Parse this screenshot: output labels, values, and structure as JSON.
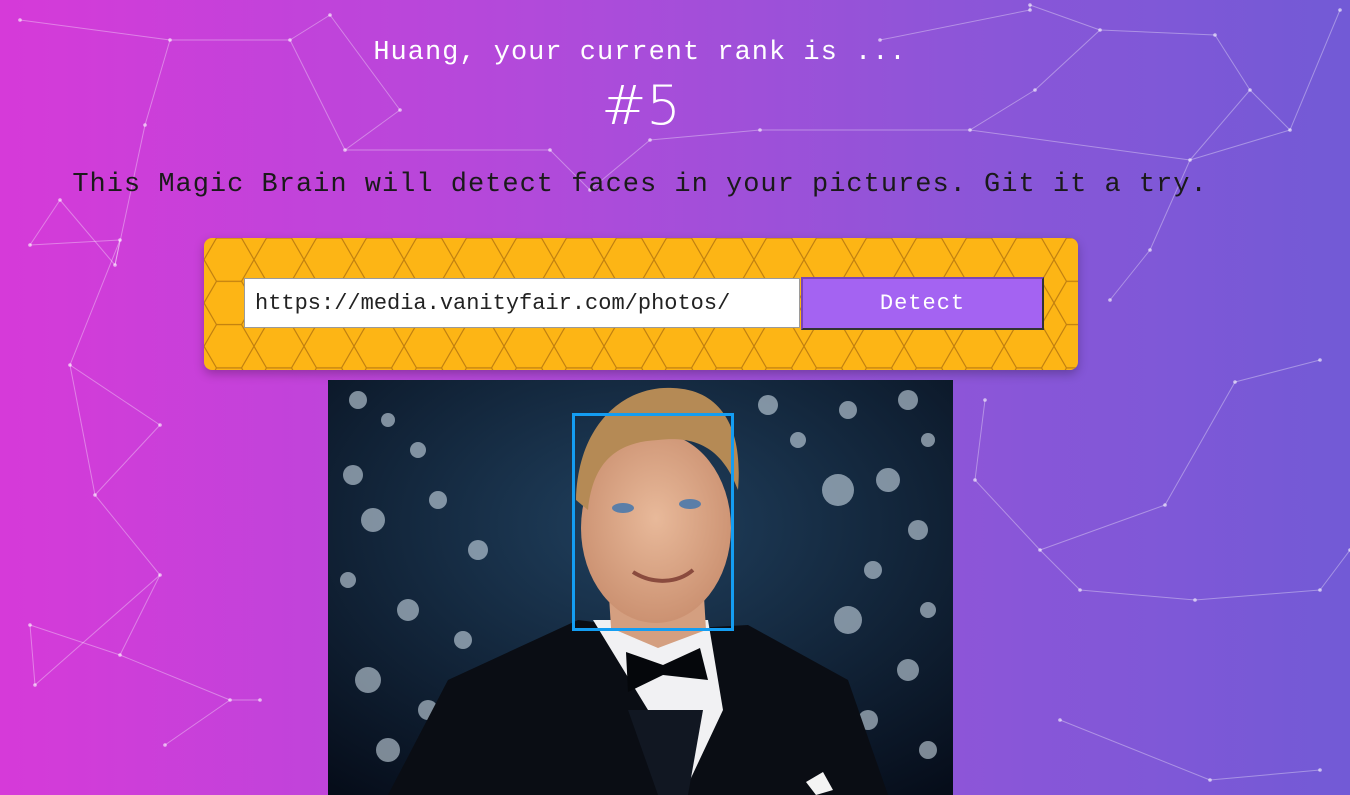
{
  "rank": {
    "greeting": "Huang, your current rank is ...",
    "number": "#5"
  },
  "description": "This Magic Brain will detect faces in your pictures. Git it a try.",
  "form": {
    "url_value": "https://media.vanityfair.com/photos/",
    "detect_label": "Detect"
  },
  "colors": {
    "gradient_start": "#d63ad9",
    "gradient_end": "#725ad6",
    "panel": "#fdb515",
    "button": "#a463f2",
    "face_box": "#149df2"
  },
  "icons": {
    "background": "particle-network",
    "face_box": "face-bounding-box"
  }
}
